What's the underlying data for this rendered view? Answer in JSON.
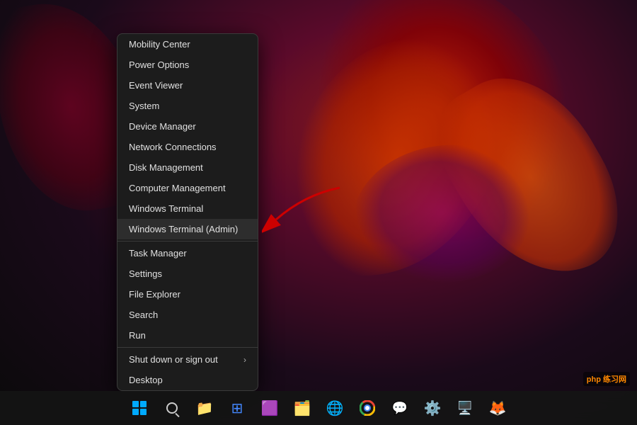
{
  "desktop": {
    "background_description": "Windows 11 dark red swirl wallpaper"
  },
  "context_menu": {
    "items": [
      {
        "id": "mobility-center",
        "label": "Mobility Center",
        "has_arrow": false
      },
      {
        "id": "power-options",
        "label": "Power Options",
        "has_arrow": false
      },
      {
        "id": "event-viewer",
        "label": "Event Viewer",
        "has_arrow": false
      },
      {
        "id": "system",
        "label": "System",
        "has_arrow": false
      },
      {
        "id": "device-manager",
        "label": "Device Manager",
        "has_arrow": false
      },
      {
        "id": "network-connections",
        "label": "Network Connections",
        "has_arrow": false
      },
      {
        "id": "disk-management",
        "label": "Disk Management",
        "has_arrow": false
      },
      {
        "id": "computer-management",
        "label": "Computer Management",
        "has_arrow": false
      },
      {
        "id": "windows-terminal",
        "label": "Windows Terminal",
        "has_arrow": false
      },
      {
        "id": "windows-terminal-admin",
        "label": "Windows Terminal (Admin)",
        "has_arrow": false,
        "highlighted": true
      },
      {
        "id": "task-manager",
        "label": "Task Manager",
        "has_arrow": false
      },
      {
        "id": "settings",
        "label": "Settings",
        "has_arrow": false
      },
      {
        "id": "file-explorer",
        "label": "File Explorer",
        "has_arrow": false
      },
      {
        "id": "search",
        "label": "Search",
        "has_arrow": false
      },
      {
        "id": "run",
        "label": "Run",
        "has_arrow": false
      },
      {
        "id": "shut-down",
        "label": "Shut down or sign out",
        "has_arrow": true
      },
      {
        "id": "desktop",
        "label": "Desktop",
        "has_arrow": false
      }
    ]
  },
  "taskbar": {
    "icons": [
      {
        "id": "start",
        "label": "Start",
        "type": "winlogo"
      },
      {
        "id": "search",
        "label": "Search",
        "type": "search"
      },
      {
        "id": "files",
        "label": "File Explorer",
        "type": "files"
      },
      {
        "id": "widgets",
        "label": "Widgets",
        "type": "widgets"
      },
      {
        "id": "teams",
        "label": "Microsoft Teams",
        "type": "teams"
      },
      {
        "id": "explorer2",
        "label": "File Explorer 2",
        "type": "folder"
      },
      {
        "id": "edge",
        "label": "Microsoft Edge",
        "type": "edge"
      },
      {
        "id": "chrome",
        "label": "Google Chrome",
        "type": "chrome"
      },
      {
        "id": "slack",
        "label": "Slack",
        "type": "slack"
      },
      {
        "id": "settings",
        "label": "Settings",
        "type": "gear"
      },
      {
        "id": "rdp",
        "label": "Remote Desktop",
        "type": "rdp"
      },
      {
        "id": "firefox",
        "label": "Firefox",
        "type": "firefox"
      }
    ]
  },
  "annotation": {
    "arrow_label": "Red arrow pointing to Windows Terminal (Admin)"
  },
  "watermark": {
    "text": "php 练习网"
  }
}
